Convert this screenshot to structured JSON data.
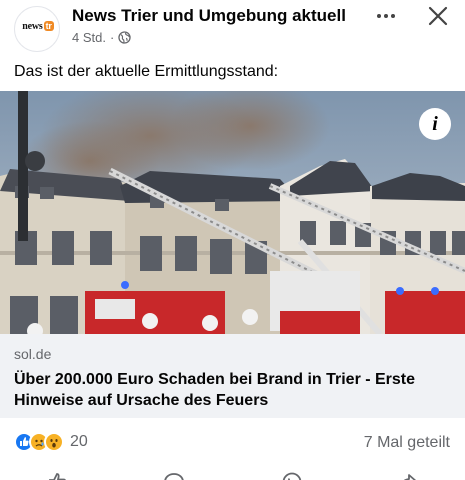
{
  "post": {
    "page_name": "News Trier und Umgebung aktuell",
    "avatar_logo_main": "news",
    "avatar_logo_badge": "tr",
    "time": "4 Std.",
    "separator": "·",
    "privacy_icon": "globe-icon",
    "more_icon": "more-dots-icon",
    "close_icon": "close-icon",
    "text": "Das ist der aktuelle Ermittlungsstand:"
  },
  "image": {
    "info_label": "i"
  },
  "link_preview": {
    "domain": "sol.de",
    "title": "Über 200.000 Euro Schaden bei Brand in Trier - Erste Hinweise auf Ursache des Feuers"
  },
  "footer": {
    "reactions": [
      "like-icon",
      "sad-icon",
      "wow-icon"
    ],
    "reaction_count": "20",
    "shares": "7 Mal geteilt"
  },
  "colors": {
    "brand_blue": "#1877f2",
    "muted_text": "#65676b",
    "link_bg": "#f0f2f5"
  }
}
